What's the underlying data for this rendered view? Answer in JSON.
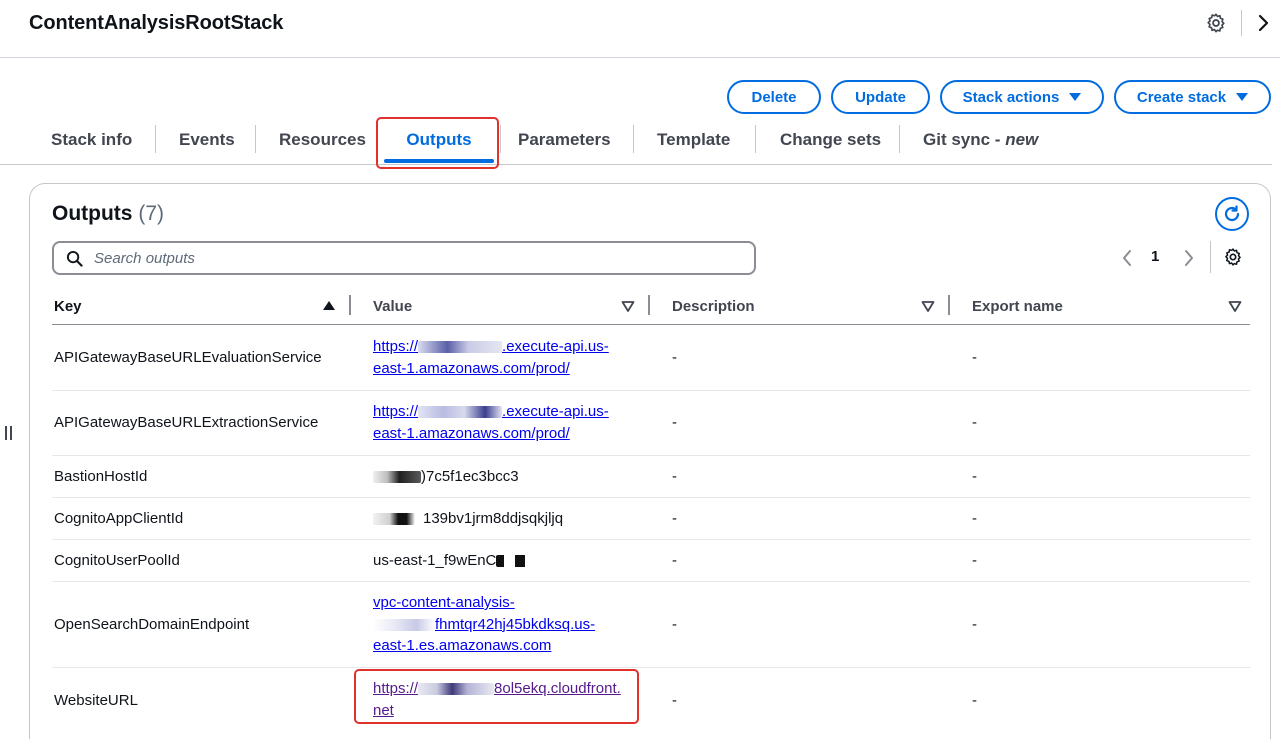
{
  "header": {
    "title": "ContentAnalysisRootStack",
    "settings_icon": "gear-icon",
    "collapse_icon": "chevron-right-icon"
  },
  "actions": {
    "delete": "Delete",
    "update": "Update",
    "stack_actions": "Stack actions",
    "create_stack": "Create stack"
  },
  "tabs": [
    {
      "label": "Stack info"
    },
    {
      "label": "Events"
    },
    {
      "label": "Resources"
    },
    {
      "label": "Outputs",
      "active": true
    },
    {
      "label": "Parameters"
    },
    {
      "label": "Template"
    },
    {
      "label": "Change sets"
    },
    {
      "label": "Git sync - ",
      "suffix": "new"
    }
  ],
  "outputs_panel": {
    "title": "Outputs",
    "count": "(7)",
    "search_placeholder": "Search outputs",
    "page": "1",
    "columns": {
      "key": "Key",
      "value": "Value",
      "description": "Description",
      "export_name": "Export name"
    },
    "rows": [
      {
        "key": "APIGatewayBaseURLEvaluationService",
        "value_lines": [
          "https://",
          ".execute-api.us-",
          "east-1.amazonaws.com/prod/"
        ],
        "description": "-",
        "export_name": "-"
      },
      {
        "key": "APIGatewayBaseURLExtractionService",
        "value_lines": [
          "https://",
          ".execute-api.us-",
          "east-1.amazonaws.com/prod/"
        ],
        "description": "-",
        "export_name": "-"
      },
      {
        "key": "BastionHostId",
        "value_lines": [
          "",
          ")7c5f1ec3bcc3"
        ],
        "description": "-",
        "export_name": "-"
      },
      {
        "key": "CognitoAppClientId",
        "value_lines": [
          "",
          "139bv1jrm8ddjsqkjljq"
        ],
        "description": "-",
        "export_name": "-"
      },
      {
        "key": "CognitoUserPoolId",
        "value_lines": [
          "us-east-1_f9wEnC",
          ""
        ],
        "description": "-",
        "export_name": "-"
      },
      {
        "key": "OpenSearchDomainEndpoint",
        "value_lines": [
          "vpc-content-analysis-",
          "fhmtqr42hj45bkdksq.us-",
          "east-1.es.amazonaws.com"
        ],
        "description": "-",
        "export_name": "-"
      },
      {
        "key": "WebsiteURL",
        "value_lines": [
          "https://",
          "8ol5ekq.cloudfront.",
          "net"
        ],
        "description": "-",
        "export_name": "-"
      }
    ]
  },
  "colors": {
    "accent": "#006ce0",
    "highlight": "#e0312b",
    "link": "#0000ee",
    "visited_link": "#551a8b"
  }
}
